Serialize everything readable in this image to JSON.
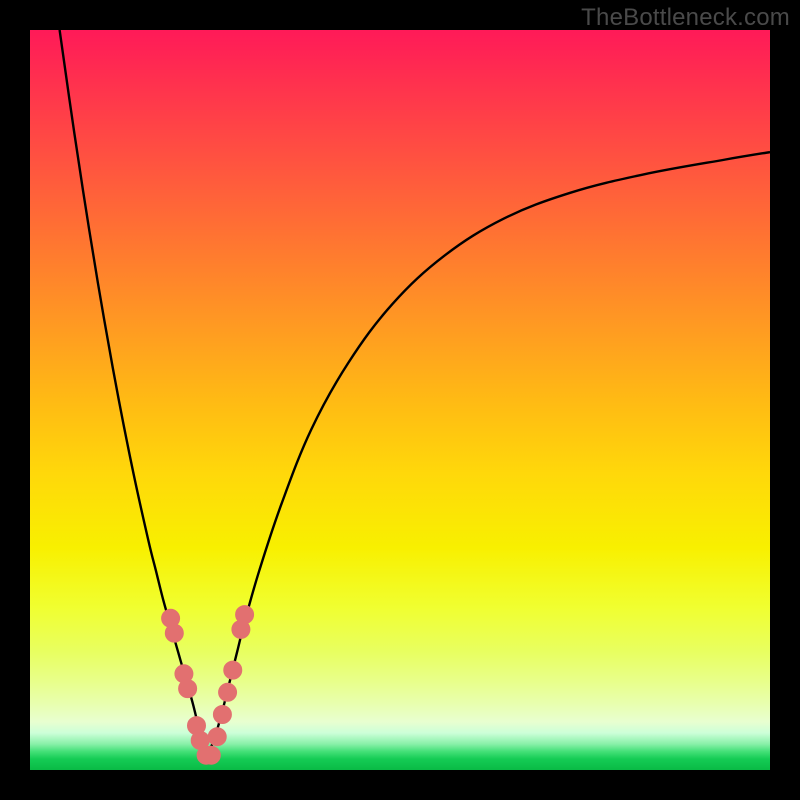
{
  "watermark": "TheBottleneck.com",
  "colors": {
    "background": "#000000",
    "curve": "#000000",
    "dot": "#e27070",
    "gradient_top": "#ff1a58",
    "gradient_bottom": "#0aba45"
  },
  "chart_data": {
    "type": "line",
    "title": "",
    "xlabel": "",
    "ylabel": "",
    "xlim": [
      0,
      100
    ],
    "ylim": [
      0,
      100
    ],
    "series": [
      {
        "name": "left_branch",
        "x": [
          4,
          6,
          8,
          10,
          12,
          14,
          16,
          17,
          18,
          19,
          20,
          21,
          22,
          23,
          24
        ],
        "values": [
          100,
          86,
          73,
          61,
          50,
          40,
          31,
          27,
          23,
          19.5,
          16,
          12.5,
          9,
          5,
          2
        ]
      },
      {
        "name": "right_branch",
        "x": [
          24,
          25,
          26,
          27,
          28,
          29,
          31,
          34,
          38,
          43,
          49,
          56,
          64,
          73,
          83,
          94,
          100
        ],
        "values": [
          2,
          4.5,
          8,
          12,
          16,
          20,
          27,
          36,
          46,
          55,
          63,
          69.5,
          74.5,
          78,
          80.5,
          82.5,
          83.5
        ]
      }
    ],
    "dots": {
      "name": "markers",
      "x": [
        19.0,
        19.5,
        20.8,
        21.3,
        22.5,
        23.0,
        23.8,
        24.5,
        25.3,
        26.0,
        26.7,
        27.4,
        28.5,
        29.0
      ],
      "values": [
        20.5,
        18.5,
        13.0,
        11.0,
        6.0,
        4.0,
        2.0,
        2.0,
        4.5,
        7.5,
        10.5,
        13.5,
        19.0,
        21.0
      ]
    }
  }
}
